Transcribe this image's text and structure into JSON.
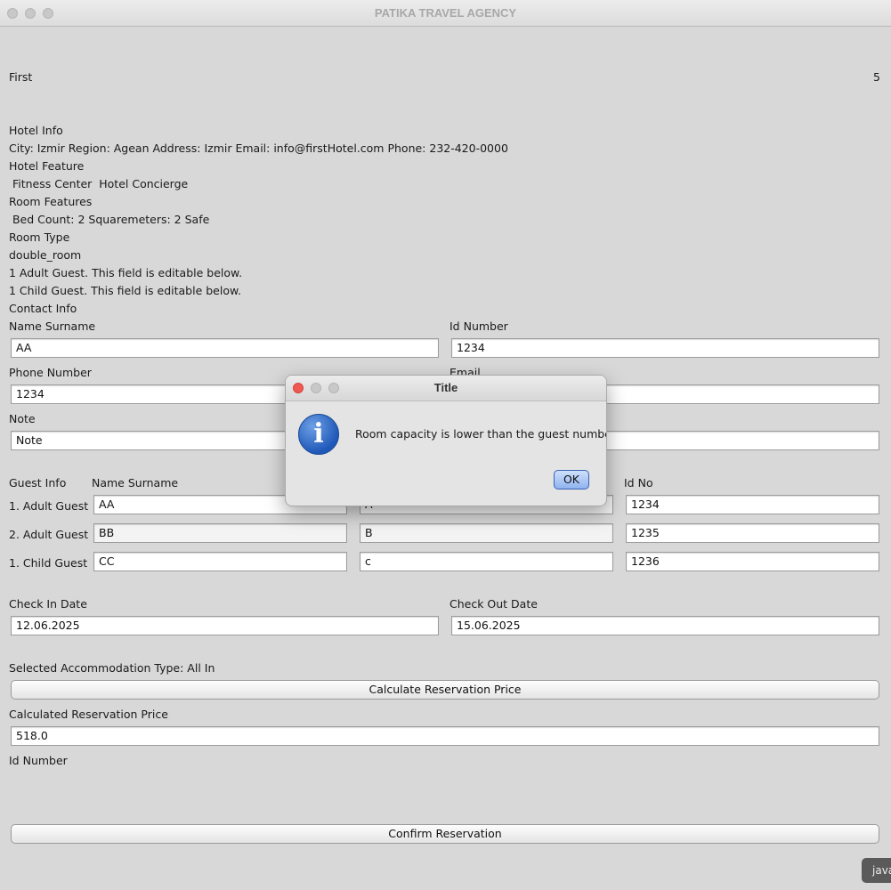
{
  "window": {
    "title": "PATIKA TRAVEL AGENCY"
  },
  "hotel": {
    "name": "First",
    "stars": "5",
    "info_heading": "Hotel Info",
    "info_line": "City: Izmir Region: Agean Address: Izmir Email: info@firstHotel.com Phone: 232-420-0000",
    "feature_heading": "Hotel Feature",
    "feature_line": " Fitness Center  Hotel Concierge",
    "room_features_heading": "Room Features",
    "room_features_line": " Bed Count: 2 Squaremeters: 2 Safe",
    "room_type_heading": "Room Type",
    "room_type_value": "double_room",
    "adult_guest_note": "1 Adult Guest. This field is editable below.",
    "child_guest_note": "1 Child Guest. This field is editable below."
  },
  "contact": {
    "heading": "Contact Info",
    "name_label": "Name Surname",
    "name_value": "AA",
    "id_label": "Id Number",
    "id_value": "1234",
    "phone_label": "Phone Number",
    "phone_value": "1234",
    "email_label": "Email",
    "email_value": "",
    "note_label": "Note",
    "note_value": "Note",
    "note_right_value": ""
  },
  "guests": {
    "heading": "Guest Info",
    "col_name": "Name Surname",
    "col_id": "Id No",
    "rows": [
      {
        "label": "1. Adult Guest",
        "name": "AA",
        "surname": "A",
        "id": "1234"
      },
      {
        "label": "2. Adult Guest",
        "name": "BB",
        "surname": "B",
        "id": "1235"
      },
      {
        "label": "1. Child Guest",
        "name": "CC",
        "surname": "c",
        "id": "1236"
      }
    ]
  },
  "dates": {
    "checkin_label": "Check In Date",
    "checkin_value": "12.06.2025",
    "checkout_label": "Check Out Date",
    "checkout_value": "15.06.2025"
  },
  "pricing": {
    "accommodation_label": "Selected Accommodation Type: All In",
    "calculate_button": "Calculate Reservation Price",
    "price_label": "Calculated Reservation Price",
    "price_value": "518.0",
    "id_number_label": "Id Number",
    "confirm_button": "Confirm Reservation"
  },
  "dialog": {
    "title": "Title",
    "message": "Room capacity is lower than the guest number",
    "ok_button": "OK",
    "icon": "info-icon"
  },
  "dock": {
    "java_label": "java"
  }
}
